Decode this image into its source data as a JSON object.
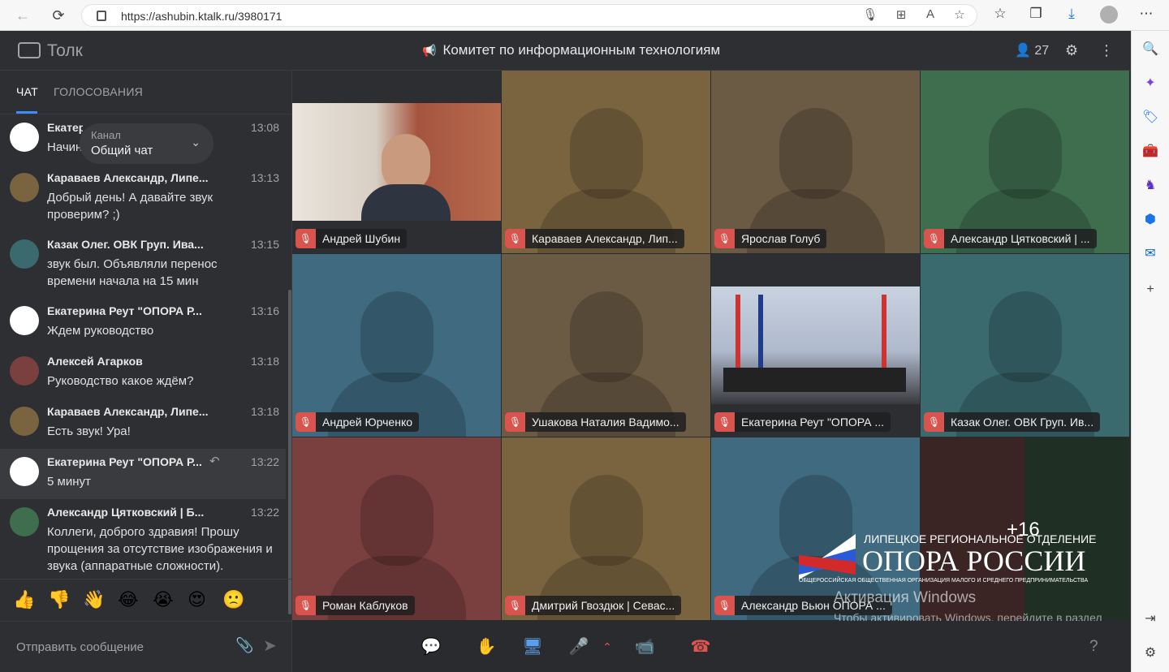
{
  "browser": {
    "url": "https://ashubin.ktalk.ru/3980171"
  },
  "app": {
    "logo": "Толк",
    "title": "Комитет по информационным технологиям",
    "participants": "27"
  },
  "chat": {
    "tabs": [
      "ЧАТ",
      "ГОЛОСОВАНИЯ"
    ],
    "channel": {
      "label": "Канал",
      "value": "Общий чат"
    },
    "messages": [
      {
        "sender": "Екатерина Реут \"ОПОРА Р...",
        "time": "13:08",
        "text": "Начинаем"
      },
      {
        "sender": "Караваев Александр, Липе...",
        "time": "13:13",
        "text": "Добрый день! А давайте звук проверим? ;)"
      },
      {
        "sender": "Казак Олег. ОВК Груп. Ива...",
        "time": "13:15",
        "text": "звук был. Объявляли перенос времени начала на 15 мин"
      },
      {
        "sender": "Екатерина Реут \"ОПОРА Р...",
        "time": "13:16",
        "text": "Ждем руководство"
      },
      {
        "sender": "Алексей Агарков",
        "time": "13:18",
        "text": "Руководство какое ждём?"
      },
      {
        "sender": "Караваев Александр, Липе...",
        "time": "13:18",
        "text": "Есть звук! Ура!"
      },
      {
        "sender": "Екатерина Реут \"ОПОРА Р...",
        "time": "13:22",
        "text": "5 минут"
      },
      {
        "sender": "Александр Цятковский | Б...",
        "time": "13:22",
        "text": "Коллеги, доброго здравия! Прошу прощения за отсутствие изображения и звука (аппаратные сложности)."
      }
    ],
    "reactions": [
      "👍",
      "👎",
      "👋",
      "😂",
      "😭",
      "😍",
      "🙁"
    ],
    "composer_placeholder": "Отправить сообщение"
  },
  "tiles": [
    {
      "name": "Андрей Шубин",
      "color": "#2d2e31"
    },
    {
      "name": "Караваев Александр, Лип...",
      "color": "#7a6440"
    },
    {
      "name": "Ярослав Голуб",
      "color": "#6b5a44"
    },
    {
      "name": "Александр Цятковский | ...",
      "color": "#3f6e4f"
    },
    {
      "name": "Андрей Юрченко",
      "color": "#3f6a80"
    },
    {
      "name": "Ушакова Наталия Вадимо...",
      "color": "#6b5a44"
    },
    {
      "name": "Екатерина Реут \"ОПОРА ...",
      "color": "#2d2e31"
    },
    {
      "name": "Казак Олег. ОВК Груп. Ив...",
      "color": "#3a6a6e"
    },
    {
      "name": "Роман Каблуков",
      "color": "#7a3f3f"
    },
    {
      "name": "Дмитрий Гвоздюк | Севас...",
      "color": "#7a6440"
    },
    {
      "name": "Александр Вьюн ОПОРА ...",
      "color": "#3f6a80"
    }
  ],
  "more_participants": "+16",
  "watermark": {
    "org_top": "ЛИПЕЦКОЕ РЕГИОНАЛЬНОЕ ОТДЕЛЕНИЕ",
    "org_main": "ОПОРА РОССИИ",
    "org_sub": "ОБЩЕРОССИЙСКАЯ ОБЩЕСТВЕННАЯ ОРГАНИЗАЦИЯ МАЛОГО И СРЕДНЕГО ПРЕДПРИНИМАТЕЛЬСТВА",
    "win_title": "Активация Windows",
    "win_text": "Чтобы активировать Windows, перейдите в раздел \"Параметры\"."
  }
}
